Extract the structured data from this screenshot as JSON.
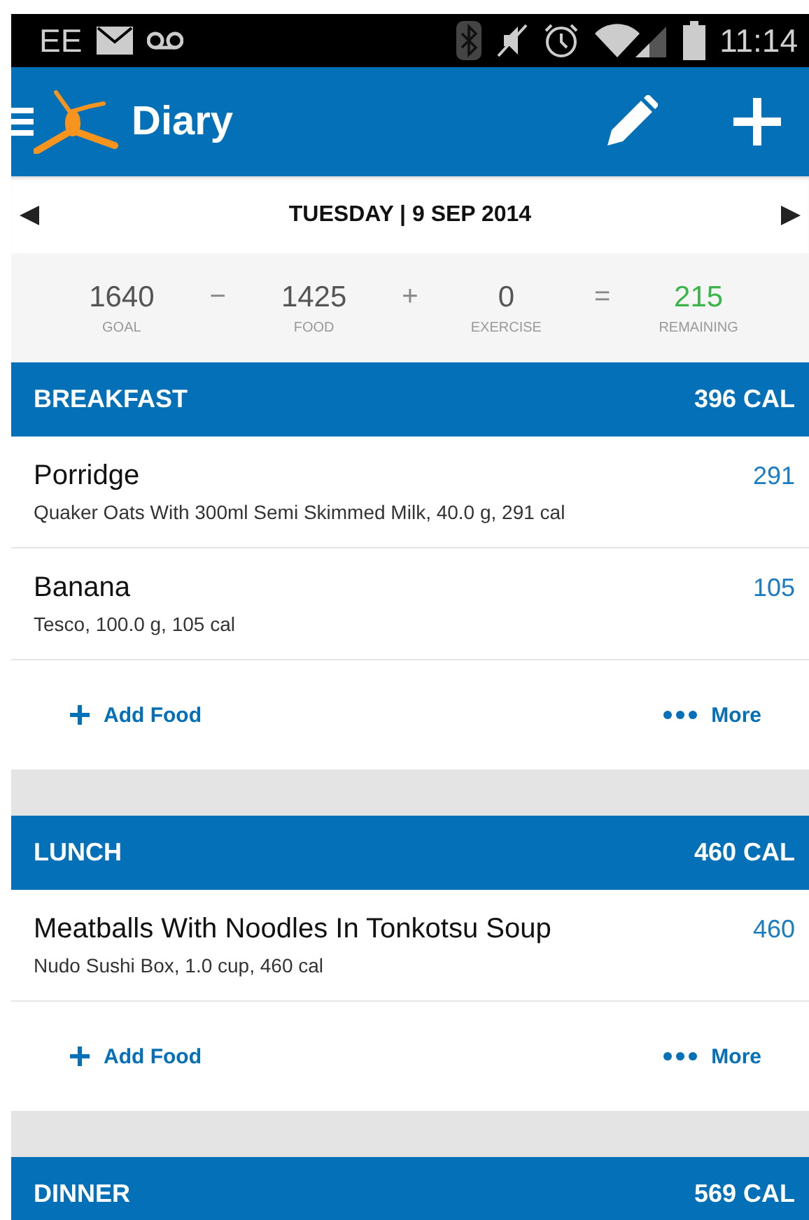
{
  "status_bar": {
    "carrier": "EE",
    "time": "11:14"
  },
  "app_bar": {
    "title": "Diary"
  },
  "date": {
    "label": "TUESDAY | 9 SEP 2014"
  },
  "summary": [
    {
      "value": "1640",
      "label": "GOAL",
      "kind": "plain"
    },
    {
      "op": "−"
    },
    {
      "value": "1425",
      "label": "FOOD",
      "kind": "plain"
    },
    {
      "op": "+"
    },
    {
      "value": "0",
      "label": "EXERCISE",
      "kind": "plain"
    },
    {
      "op": "="
    },
    {
      "value": "215",
      "label": "REMAINING",
      "kind": "positive"
    }
  ],
  "meals": [
    {
      "name": "BREAKFAST",
      "calories": "396 CAL",
      "items": [
        {
          "name": "Porridge",
          "detail": "Quaker Oats With 300ml Semi Skimmed Milk, 40.0 g, 291 cal",
          "calories": "291"
        },
        {
          "name": "Banana",
          "detail": "Tesco, 100.0 g, 105 cal",
          "calories": "105"
        }
      ],
      "add_label": "Add Food",
      "more_label": "More"
    },
    {
      "name": "LUNCH",
      "calories": "460 CAL",
      "items": [
        {
          "name": "Meatballs With Noodles In Tonkotsu Soup",
          "detail": "Nudo Sushi Box, 1.0 cup, 460 cal",
          "calories": "460"
        }
      ],
      "add_label": "Add Food",
      "more_label": "More"
    },
    {
      "name": "DINNER",
      "calories": "569 CAL"
    }
  ]
}
